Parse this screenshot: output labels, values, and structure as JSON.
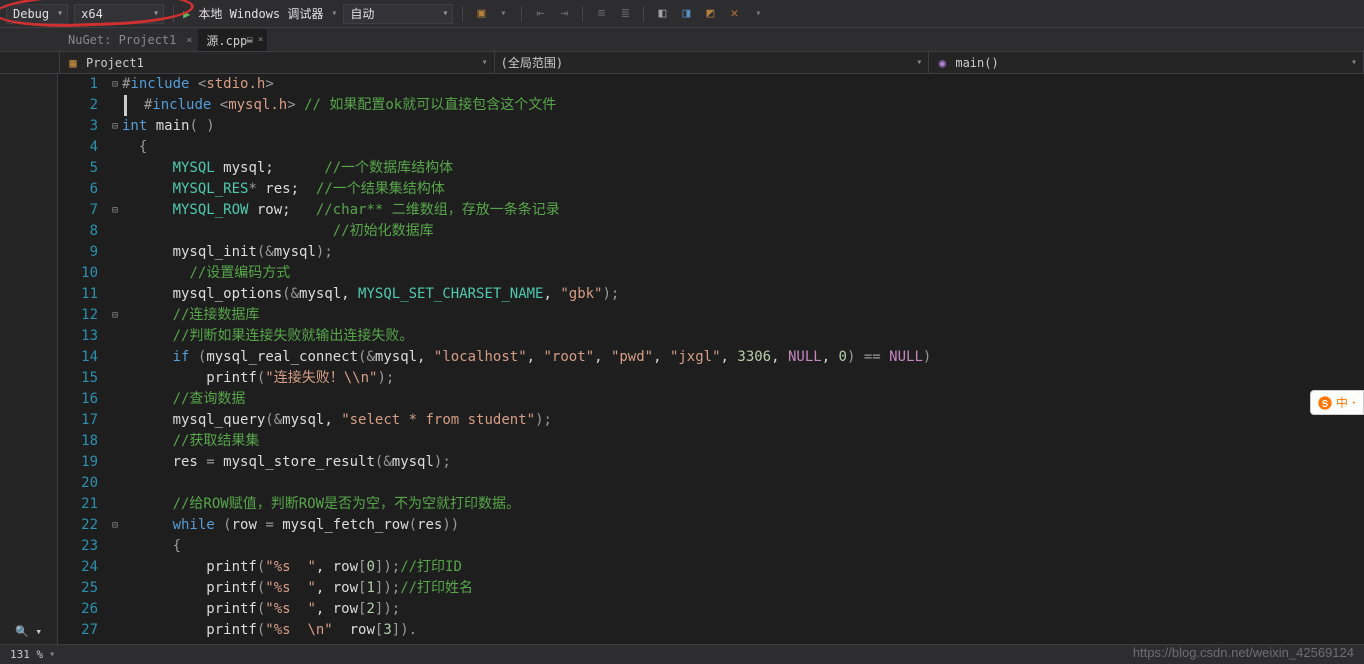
{
  "toolbar": {
    "config": "Debug",
    "platform": "x64",
    "debugger_label": "本地 Windows 调试器",
    "auto_label": "自动"
  },
  "tabs": {
    "nuget": "NuGet: Project1",
    "source": "源.cpp"
  },
  "nav": {
    "project": "Project1",
    "scope": "(全局范围)",
    "func": "main()"
  },
  "code": {
    "lines": [
      {
        "n": 1,
        "fold": "⊟",
        "seg": [
          [
            "cp",
            "#"
          ],
          [
            "ck",
            "include"
          ],
          [
            "cd",
            " "
          ],
          [
            "cp",
            "<"
          ],
          [
            "cs",
            "stdio.h"
          ],
          [
            "cp",
            ">"
          ]
        ]
      },
      {
        "n": 2,
        "fold": "",
        "seg": [
          [
            "cp",
            "  #"
          ],
          [
            "ck",
            "include"
          ],
          [
            "cd",
            " "
          ],
          [
            "cp",
            "<"
          ],
          [
            "cs",
            "mysql.h"
          ],
          [
            "cp",
            ">"
          ],
          [
            "cd",
            " "
          ],
          [
            "cc",
            "// 如果配置ok就可以直接包含这个文件"
          ]
        ],
        "caret": true
      },
      {
        "n": 3,
        "fold": "⊟",
        "seg": [
          [
            "ck",
            "int"
          ],
          [
            "cd",
            " "
          ],
          [
            "cd",
            "main"
          ],
          [
            "cp",
            "( )"
          ]
        ]
      },
      {
        "n": 4,
        "fold": "",
        "seg": [
          [
            "cd",
            "  "
          ],
          [
            "cp",
            "{"
          ]
        ]
      },
      {
        "n": 5,
        "fold": "",
        "seg": [
          [
            "cd",
            "      "
          ],
          [
            "ct",
            "MYSQL"
          ],
          [
            "cd",
            " mysql;      "
          ],
          [
            "cc",
            "//一个数据库结构体"
          ]
        ]
      },
      {
        "n": 6,
        "fold": "",
        "seg": [
          [
            "cd",
            "      "
          ],
          [
            "ct",
            "MYSQL_RES"
          ],
          [
            "cp",
            "*"
          ],
          [
            "cd",
            " res;  "
          ],
          [
            "cc",
            "//一个结果集结构体"
          ]
        ]
      },
      {
        "n": 7,
        "fold": "⊟",
        "seg": [
          [
            "cd",
            "      "
          ],
          [
            "ct",
            "MYSQL_ROW"
          ],
          [
            "cd",
            " row;   "
          ],
          [
            "cc",
            "//char** 二维数组，存放一条条记录"
          ]
        ]
      },
      {
        "n": 8,
        "fold": "",
        "seg": [
          [
            "cd",
            "                         "
          ],
          [
            "cc",
            "//初始化数据库"
          ]
        ]
      },
      {
        "n": 9,
        "fold": "",
        "seg": [
          [
            "cd",
            "      mysql_init"
          ],
          [
            "cp",
            "("
          ],
          [
            "cp",
            "&"
          ],
          [
            "cd",
            "mysql"
          ],
          [
            "cp",
            ");"
          ]
        ]
      },
      {
        "n": 10,
        "fold": "",
        "seg": [
          [
            "cd",
            "        "
          ],
          [
            "cc",
            "//设置编码方式"
          ]
        ]
      },
      {
        "n": 11,
        "fold": "",
        "seg": [
          [
            "cd",
            "      mysql_options"
          ],
          [
            "cp",
            "("
          ],
          [
            "cp",
            "&"
          ],
          [
            "cd",
            "mysql, "
          ],
          [
            "ct",
            "MYSQL_SET_CHARSET_NAME"
          ],
          [
            "cd",
            ", "
          ],
          [
            "cs",
            "\"gbk\""
          ],
          [
            "cp",
            ");"
          ]
        ]
      },
      {
        "n": 12,
        "fold": "⊟",
        "seg": [
          [
            "cd",
            "      "
          ],
          [
            "cc",
            "//连接数据库"
          ]
        ]
      },
      {
        "n": 13,
        "fold": "",
        "seg": [
          [
            "cd",
            "      "
          ],
          [
            "cc",
            "//判断如果连接失败就输出连接失败。"
          ]
        ]
      },
      {
        "n": 14,
        "fold": "",
        "seg": [
          [
            "cd",
            "      "
          ],
          [
            "ck",
            "if"
          ],
          [
            "cd",
            " "
          ],
          [
            "cp",
            "("
          ],
          [
            "cd",
            "mysql_real_connect"
          ],
          [
            "cp",
            "("
          ],
          [
            "cp",
            "&"
          ],
          [
            "cd",
            "mysql, "
          ],
          [
            "cs",
            "\"localhost\""
          ],
          [
            "cd",
            ", "
          ],
          [
            "cs",
            "\"root\""
          ],
          [
            "cd",
            ", "
          ],
          [
            "cs",
            "\"pwd\""
          ],
          [
            "cd",
            ", "
          ],
          [
            "cs",
            "\"jxgl\""
          ],
          [
            "cd",
            ", "
          ],
          [
            "cn",
            "3306"
          ],
          [
            "cd",
            ", "
          ],
          [
            "cm",
            "NULL"
          ],
          [
            "cd",
            ", "
          ],
          [
            "cn",
            "0"
          ],
          [
            "cp",
            ")"
          ],
          [
            "cd",
            " "
          ],
          [
            "cp",
            "=="
          ],
          [
            "cd",
            " "
          ],
          [
            "cm",
            "NULL"
          ],
          [
            "cp",
            ")"
          ]
        ]
      },
      {
        "n": 15,
        "fold": "",
        "seg": [
          [
            "cd",
            "          printf"
          ],
          [
            "cp",
            "("
          ],
          [
            "cs",
            "\"连接失败！\\\\n\""
          ],
          [
            "cp",
            ");"
          ]
        ]
      },
      {
        "n": 16,
        "fold": "",
        "seg": [
          [
            "cd",
            "      "
          ],
          [
            "cc",
            "//查询数据"
          ]
        ]
      },
      {
        "n": 17,
        "fold": "",
        "seg": [
          [
            "cd",
            "      mysql_query"
          ],
          [
            "cp",
            "("
          ],
          [
            "cp",
            "&"
          ],
          [
            "cd",
            "mysql, "
          ],
          [
            "cs",
            "\"select * from student\""
          ],
          [
            "cp",
            ");"
          ]
        ]
      },
      {
        "n": 18,
        "fold": "",
        "seg": [
          [
            "cd",
            "      "
          ],
          [
            "cc",
            "//获取结果集"
          ]
        ]
      },
      {
        "n": 19,
        "fold": "",
        "seg": [
          [
            "cd",
            "      res "
          ],
          [
            "cp",
            "="
          ],
          [
            "cd",
            " mysql_store_result"
          ],
          [
            "cp",
            "("
          ],
          [
            "cp",
            "&"
          ],
          [
            "cd",
            "mysql"
          ],
          [
            "cp",
            ");"
          ]
        ]
      },
      {
        "n": 20,
        "fold": "",
        "seg": [
          [
            "cd",
            " "
          ]
        ]
      },
      {
        "n": 21,
        "fold": "",
        "seg": [
          [
            "cd",
            "      "
          ],
          [
            "cc",
            "//给ROW赋值，判断ROW是否为空，不为空就打印数据。"
          ]
        ]
      },
      {
        "n": 22,
        "fold": "⊟",
        "seg": [
          [
            "cd",
            "      "
          ],
          [
            "ck",
            "while"
          ],
          [
            "cd",
            " "
          ],
          [
            "cp",
            "("
          ],
          [
            "cd",
            "row "
          ],
          [
            "cp",
            "="
          ],
          [
            "cd",
            " mysql_fetch_row"
          ],
          [
            "cp",
            "("
          ],
          [
            "cd",
            "res"
          ],
          [
            "cp",
            "))"
          ]
        ]
      },
      {
        "n": 23,
        "fold": "",
        "seg": [
          [
            "cd",
            "      "
          ],
          [
            "cp",
            "{"
          ]
        ]
      },
      {
        "n": 24,
        "fold": "",
        "seg": [
          [
            "cd",
            "          printf"
          ],
          [
            "cp",
            "("
          ],
          [
            "cs",
            "\"%s  \""
          ],
          [
            "cd",
            ", row"
          ],
          [
            "cp",
            "["
          ],
          [
            "cn",
            "0"
          ],
          [
            "cp",
            "]);"
          ],
          [
            "cc",
            "//打印ID"
          ]
        ]
      },
      {
        "n": 25,
        "fold": "",
        "seg": [
          [
            "cd",
            "          printf"
          ],
          [
            "cp",
            "("
          ],
          [
            "cs",
            "\"%s  \""
          ],
          [
            "cd",
            ", row"
          ],
          [
            "cp",
            "["
          ],
          [
            "cn",
            "1"
          ],
          [
            "cp",
            "]);"
          ],
          [
            "cc",
            "//打印姓名"
          ]
        ]
      },
      {
        "n": 26,
        "fold": "",
        "seg": [
          [
            "cd",
            "          printf"
          ],
          [
            "cp",
            "("
          ],
          [
            "cs",
            "\"%s  \""
          ],
          [
            "cd",
            ", row"
          ],
          [
            "cp",
            "["
          ],
          [
            "cn",
            "2"
          ],
          [
            "cp",
            "]);"
          ]
        ]
      },
      {
        "n": 27,
        "fold": "",
        "seg": [
          [
            "cd",
            "          printf"
          ],
          [
            "cp",
            "("
          ],
          [
            "cs",
            "\"%s  \\n\""
          ],
          [
            "cd",
            "  row"
          ],
          [
            "cp",
            "["
          ],
          [
            "cn",
            "3"
          ],
          [
            "cp",
            "])."
          ]
        ]
      }
    ]
  },
  "status": {
    "zoom": "131 %"
  },
  "watermark": "https://blog.csdn.net/weixin_42569124",
  "sogou": "中"
}
